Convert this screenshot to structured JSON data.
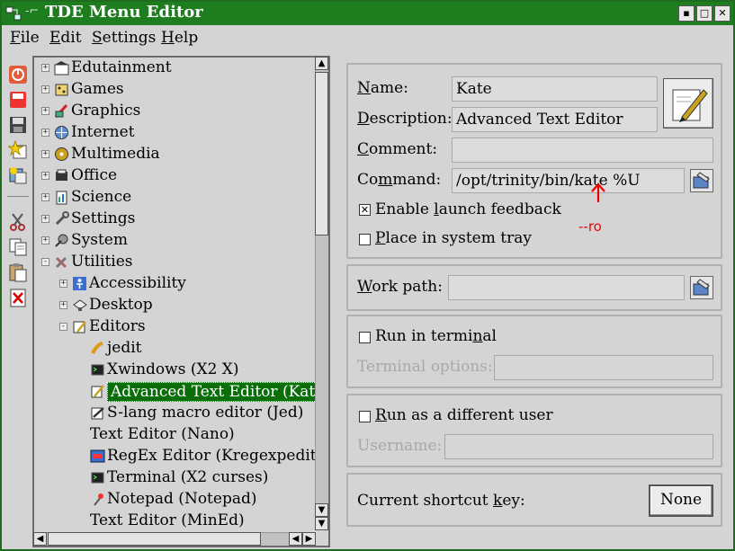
{
  "window": {
    "title": "TDE Menu Editor"
  },
  "menubar": {
    "items": [
      {
        "mnemonic": "F",
        "rest": "ile"
      },
      {
        "mnemonic": "E",
        "rest": "dit"
      },
      {
        "mnemonic": "S",
        "rest": "ettings"
      },
      {
        "mnemonic": "H",
        "rest": "elp"
      }
    ]
  },
  "toolbar": {
    "icons": [
      "shutdown-icon",
      "new-item-icon",
      "save-icon",
      "new-submenu-icon",
      "new-separator-icon",
      "cut-icon",
      "copy-icon",
      "paste-icon",
      "delete-icon"
    ]
  },
  "tree": {
    "items": [
      {
        "label": "Edutainment",
        "expander": "+",
        "icon": "edutainment-icon"
      },
      {
        "label": "Games",
        "expander": "+",
        "icon": "games-icon"
      },
      {
        "label": "Graphics",
        "expander": "+",
        "icon": "graphics-icon"
      },
      {
        "label": "Internet",
        "expander": "+",
        "icon": "internet-icon"
      },
      {
        "label": "Multimedia",
        "expander": "+",
        "icon": "multimedia-icon"
      },
      {
        "label": "Office",
        "expander": "+",
        "icon": "office-icon"
      },
      {
        "label": "Science",
        "expander": "+",
        "icon": "science-icon"
      },
      {
        "label": "Settings",
        "expander": "+",
        "icon": "settings-icon"
      },
      {
        "label": "System",
        "expander": "+",
        "icon": "system-icon"
      },
      {
        "label": "Utilities",
        "expander": "-",
        "icon": "utilities-icon"
      },
      {
        "label": "Accessibility",
        "expander": "+",
        "icon": "accessibility-icon"
      },
      {
        "label": "Desktop",
        "expander": "+",
        "icon": "desktop-icon"
      },
      {
        "label": "Editors",
        "expander": "-",
        "icon": "editors-icon"
      },
      {
        "label": "jedit",
        "expander": "",
        "icon": "jedit-icon"
      },
      {
        "label": "Xwindows (X2 X)",
        "expander": "",
        "icon": "terminal-icon"
      },
      {
        "label": "Advanced Text Editor (Kate)",
        "expander": "",
        "icon": "kate-icon",
        "selected": true
      },
      {
        "label": "S-lang macro editor (Jed)",
        "expander": "",
        "icon": "jed-icon"
      },
      {
        "label": "Text Editor (Nano)",
        "expander": "",
        "icon": ""
      },
      {
        "label": "RegEx Editor (Kregexpeditor)",
        "expander": "",
        "icon": "regex-icon"
      },
      {
        "label": "Terminal (X2 curses)",
        "expander": "",
        "icon": "terminal-icon"
      },
      {
        "label": "Notepad (Notepad)",
        "expander": "",
        "icon": "notepad-icon"
      },
      {
        "label": "Text Editor (MinEd)",
        "expander": "",
        "icon": ""
      }
    ]
  },
  "details": {
    "name": {
      "mnemonic": "N",
      "rest": "ame:",
      "value": "Kate"
    },
    "description": {
      "mnemonic": "D",
      "rest": "escription:",
      "value": "Advanced Text Editor"
    },
    "comment": {
      "mnemonic": "C",
      "rest": "omment:",
      "value": ""
    },
    "command": {
      "pre": "Co",
      "mnemonic": "m",
      "rest": "mand:",
      "value": "/opt/trinity/bin/kate %U"
    },
    "launch_feedback": {
      "pre": "Enable ",
      "mnemonic": "l",
      "rest": "aunch feedback",
      "checked": true
    },
    "system_tray": {
      "pre": "",
      "mnemonic": "P",
      "rest": "lace in system tray",
      "checked": false
    },
    "annotation": "--ro",
    "annotation_color": "#e00000"
  },
  "workpath": {
    "mnemonic": "W",
    "rest": "ork path:",
    "value": ""
  },
  "terminal": {
    "pre": "Run in termi",
    "mnemonic": "n",
    "rest": "al",
    "checked": false,
    "options_label": "Terminal options:",
    "options_value": ""
  },
  "user": {
    "pre": "",
    "mnemonic": "R",
    "rest": "un as a different user",
    "checked": false,
    "username_label": "Username:",
    "username_value": ""
  },
  "shortcut": {
    "pre": "Current shortcut ",
    "mnemonic": "k",
    "rest": "ey:",
    "button": "None"
  },
  "colors": {
    "titlebar": "#1e7d1e",
    "selection": "#0a6e0a"
  }
}
